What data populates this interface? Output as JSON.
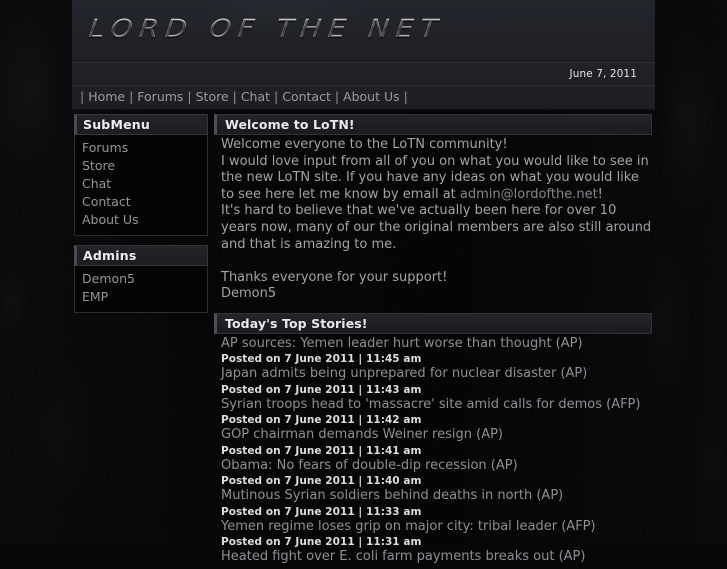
{
  "site": {
    "logo_text": "LORD OF THE NET",
    "date": "June 7, 2011"
  },
  "nav": {
    "lead_sep": "| ",
    "items": [
      {
        "label": "Home"
      },
      {
        "label": "Forums"
      },
      {
        "label": "Store"
      },
      {
        "label": "Chat"
      },
      {
        "label": "Contact"
      },
      {
        "label": "About Us"
      }
    ],
    "separator": " | ",
    "trail_sep": " |"
  },
  "sidebar": {
    "submenu": {
      "title": "SubMenu",
      "items": [
        {
          "label": "Forums"
        },
        {
          "label": "Store"
        },
        {
          "label": "Chat"
        },
        {
          "label": "Contact"
        },
        {
          "label": "About Us"
        }
      ]
    },
    "admins": {
      "title": "Admins",
      "items": [
        {
          "label": "Demon5"
        },
        {
          "label": "EMP"
        }
      ]
    }
  },
  "welcome": {
    "title": "Welcome to LoTN!",
    "line1": "Welcome everyone to the LoTN community!",
    "para2_before": "I would love input from all of you on what you would like to see in the new LoTN site. If you have any ideas on what you would like to see here let me know by email at ",
    "email_link": "admin@lordofthe.net",
    "para2_after": "!",
    "para3": "It's hard to believe that we've actually been here for over 10 years now, many of our the original members are also still around and that is amazing to me.",
    "thanks": "Thanks everyone for your support!",
    "signature": "Demon5"
  },
  "stories": {
    "title": "Today's Top Stories!",
    "items": [
      {
        "headline": "AP sources: Yemen leader hurt worse than thought (AP)",
        "meta": "Posted on 7 June 2011 | 11:45 am"
      },
      {
        "headline": "Japan admits being unprepared for nuclear disaster (AP)",
        "meta": "Posted on 7 June 2011 | 11:43 am"
      },
      {
        "headline": "Syrian troops head to 'massacre' site amid calls for demos (AFP)",
        "meta": "Posted on 7 June 2011 | 11:42 am"
      },
      {
        "headline": "GOP chairman demands Weiner resign (AP)",
        "meta": "Posted on 7 June 2011 | 11:41 am"
      },
      {
        "headline": "Obama: No fears of double-dip recession (AP)",
        "meta": "Posted on 7 June 2011 | 11:40 am"
      },
      {
        "headline": "Mutinous Syrian soldiers behind deaths in north (AP)",
        "meta": "Posted on 7 June 2011 | 11:33 am"
      },
      {
        "headline": "Yemen regime loses grip on major city: tribal leader (AFP)",
        "meta": "Posted on 7 June 2011 | 11:31 am"
      },
      {
        "headline": "Heated fight over E. coli farm payments breaks out (AP)",
        "meta": ""
      }
    ]
  },
  "colors": {
    "page_bg": "#08080a",
    "panel_bg": "#040405",
    "header_bg": "#22242b",
    "bar_text": "#e7e9ed",
    "body_text": "#a2a3a7",
    "link_text": "#8e8f94",
    "meta_text": "#dcdde1"
  }
}
